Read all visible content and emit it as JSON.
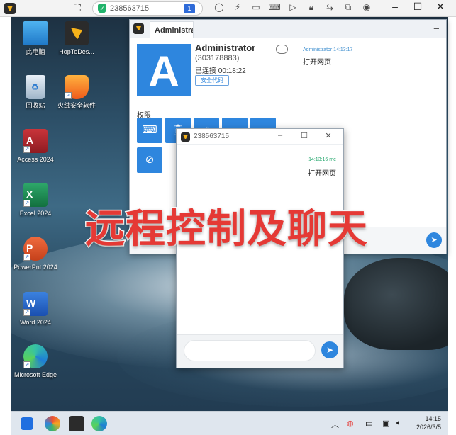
{
  "toolbar": {
    "session_id": "238563715",
    "monitor_badge": "1",
    "icons": [
      "fullscreen-icon",
      "shield-icon",
      "chat-icon",
      "lightning-icon",
      "monitor-icon",
      "keyboard-icon",
      "video-icon",
      "lock-icon",
      "swap-icon",
      "screen-icon",
      "eye-icon"
    ],
    "window_controls": [
      "–",
      "☐",
      "✕"
    ]
  },
  "desktop": {
    "icons": [
      {
        "label": "此电脑"
      },
      {
        "label": "HopToDes..."
      },
      {
        "label": "回收站"
      },
      {
        "label": "火绒安全软件"
      },
      {
        "label": "Access 2024"
      },
      {
        "label": "Excel 2024"
      },
      {
        "label": "PowerPnt 2024"
      },
      {
        "label": "Word 2024"
      },
      {
        "label": "Microsoft Edge"
      }
    ]
  },
  "taskbar": {
    "tray_lang": "中",
    "time": "14:15",
    "date": "2026/3/5"
  },
  "admin_window": {
    "tab_label": "Administrator",
    "avatar_letter": "A",
    "user_name": "Administrator",
    "user_id": "(303178883)",
    "status": "已连接 00:18:22",
    "security_code_button": "安全代码",
    "permissions_label": "权限",
    "chat": {
      "sender_meta": "Administrator 14:13:17",
      "message": "打开网页"
    }
  },
  "chat_window": {
    "title": "238563715",
    "message_meta": "14:13:16  me",
    "message": "打开网页",
    "input_placeholder": ""
  },
  "caption": "远程控制及聊天",
  "colors": {
    "accent": "#2e86de",
    "caption_red": "#e53935",
    "me_green": "#21a66b"
  }
}
